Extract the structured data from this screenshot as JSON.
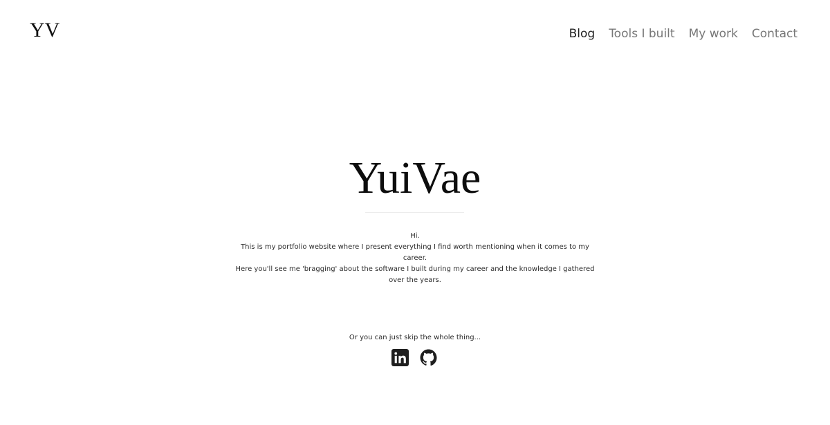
{
  "header": {
    "logo": "YV",
    "nav": {
      "blog": "Blog",
      "tools": "Tools I built",
      "work": "My work",
      "contact": "Contact"
    }
  },
  "hero": {
    "title": "YuiVae"
  },
  "intro": {
    "greeting": "Hi.",
    "line1": "This is my portfolio website where I present everything I find worth mentioning when it comes to my career.",
    "line2": "Here you'll see me 'bragging' about the software I built during my career and the knowledge I gathered over the years."
  },
  "skip": {
    "text": "Or you can just skip the whole thing..."
  },
  "socials": {
    "items": [
      "linkedin-icon",
      "github-icon"
    ]
  },
  "colors": {
    "background": "#ffffff",
    "nav_active": "#222222",
    "nav_inactive": "#777777"
  }
}
